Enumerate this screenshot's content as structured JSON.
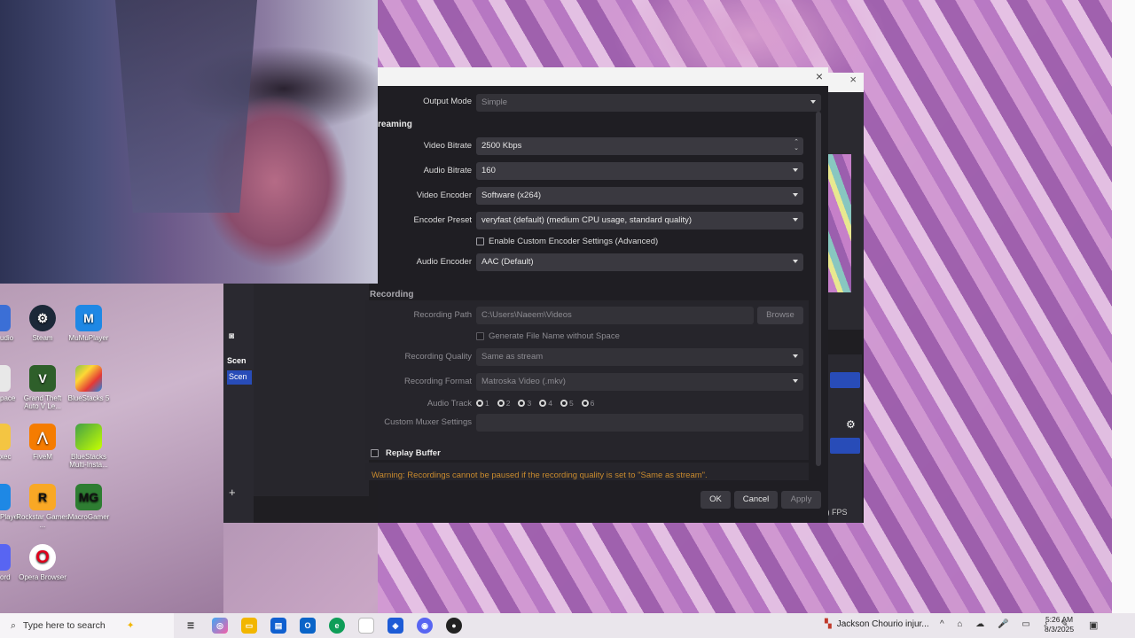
{
  "settings": {
    "close_glyph": "×",
    "output_mode": {
      "label": "Output Mode",
      "value": "Simple"
    },
    "streaming_header": "reaming",
    "video_bitrate": {
      "label": "Video Bitrate",
      "value": "2500 Kbps"
    },
    "audio_bitrate": {
      "label": "Audio Bitrate",
      "value": "160"
    },
    "video_encoder": {
      "label": "Video Encoder",
      "value": "Software (x264)"
    },
    "encoder_preset": {
      "label": "Encoder Preset",
      "value": "veryfast (default) (medium CPU usage, standard quality)"
    },
    "custom_encoder_checkbox": "Enable Custom Encoder Settings (Advanced)",
    "audio_encoder": {
      "label": "Audio Encoder",
      "value": "AAC (Default)"
    },
    "recording_header": "Recording",
    "recording_path": {
      "label": "Recording Path",
      "value": "C:\\Users\\Naeem\\Videos",
      "browse": "Browse"
    },
    "filename_checkbox": "Generate File Name without Space",
    "recording_quality": {
      "label": "Recording Quality",
      "value": "Same as stream"
    },
    "recording_format": {
      "label": "Recording Format",
      "value": "Matroska Video (.mkv)"
    },
    "audio_track": {
      "label": "Audio Track",
      "tracks": [
        "1",
        "2",
        "3",
        "4",
        "5",
        "6"
      ]
    },
    "custom_muxer": {
      "label": "Custom Muxer Settings",
      "value": ""
    },
    "replay_buffer": "Replay Buffer",
    "warning": "Warning: Recordings cannot be paused if the recording quality is set to \"Same as stream\".",
    "buttons": {
      "ok": "OK",
      "cancel": "Cancel",
      "apply": "Apply"
    }
  },
  "obs_main": {
    "scenes_label": "Scen",
    "scene_item": "Scen",
    "fps": "s) FPS",
    "ghost_close": "×"
  },
  "desktop_icons": [
    {
      "label": "udio"
    },
    {
      "label": "Steam"
    },
    {
      "label": "MuMuPlayer"
    },
    {
      "label": "pace"
    },
    {
      "label": "Grand Theft Auto V Le..."
    },
    {
      "label": "BlueStacks 5"
    },
    {
      "label": "xec"
    },
    {
      "label": "FiveM"
    },
    {
      "label": "BlueStacks Multi-Insta..."
    },
    {
      "label": "Player"
    },
    {
      "label": "Rockstar Games ..."
    },
    {
      "label": "MacroGamer"
    },
    {
      "label": "ord"
    },
    {
      "label": "Opera Browser"
    }
  ],
  "taskbar": {
    "search_placeholder": "Type here to search",
    "news": "Jackson Chourio injur...",
    "time": "5:26 AM",
    "date": "8/3/2025",
    "tray_icons": "^ ⌂ ☁ 🎤 ▭ ♪ ✎"
  },
  "colors": {
    "dialog_bg": "#1f1e23",
    "field_bg": "#3a3940",
    "warning": "#c88a2e",
    "scene_highlight": "#284cb8"
  }
}
